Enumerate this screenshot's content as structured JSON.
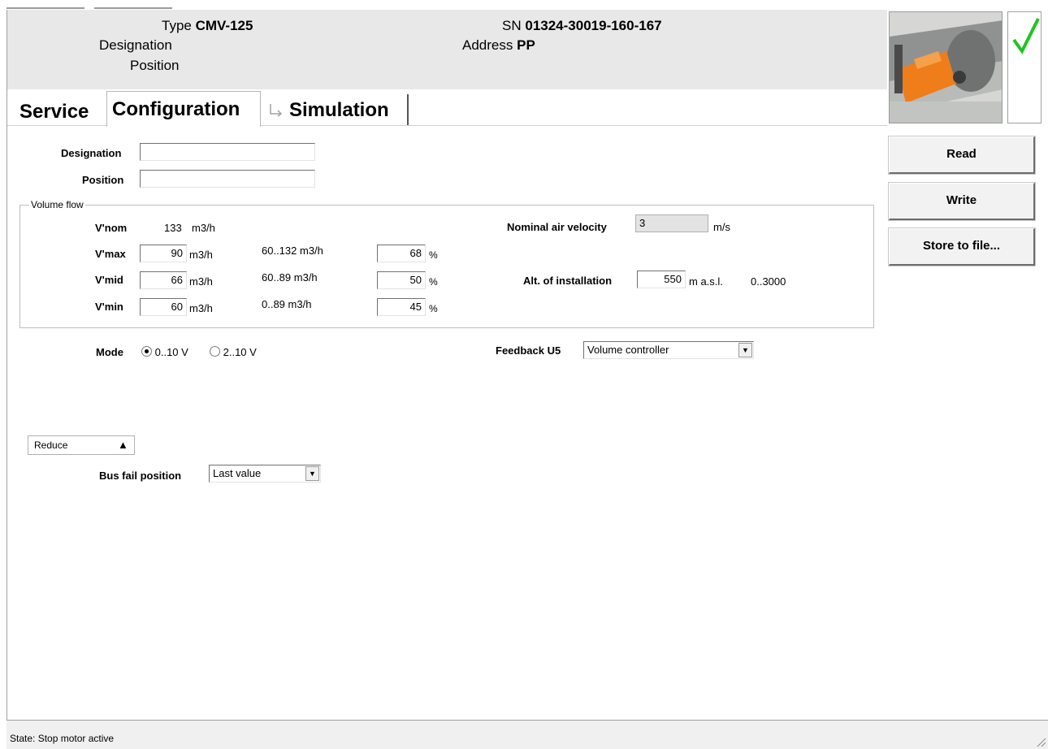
{
  "header": {
    "type_label": "Type",
    "type_value": "CMV-125",
    "designation_label": "Designation",
    "position_label": "Position",
    "sn_label": "SN",
    "sn_value": "01324-30019-160-167",
    "address_label": "Address",
    "address_value": "PP",
    "status_icon": "checkmark-icon",
    "status_color": "#22c322"
  },
  "tabs": [
    {
      "label": "Service"
    },
    {
      "label": "Configuration"
    },
    {
      "label": "Simulation",
      "icon": "route-icon"
    }
  ],
  "form": {
    "designation_label": "Designation",
    "designation_value": "",
    "position_label": "Position",
    "position_value": ""
  },
  "volume_flow": {
    "title": "Volume flow",
    "vnom_label": "V'nom",
    "vnom_value": "133",
    "vnom_unit": "m3/h",
    "vmax_label": "V'max",
    "vmax_value": "90",
    "vmax_unit": "m3/h",
    "vmax_range": "60..132 m3/h",
    "vmax_percent": "68",
    "vmid_label": "V'mid",
    "vmid_value": "66",
    "vmid_unit": "m3/h",
    "vmid_range": "60..89 m3/h",
    "vmid_percent": "50",
    "vmin_label": "V'min",
    "vmin_value": "60",
    "vmin_unit": "m3/h",
    "vmin_range": "0..89 m3/h",
    "vmin_percent": "45",
    "percent_sign": "%",
    "nominal_air_velocity_label": "Nominal air velocity",
    "nominal_air_velocity_value": "3",
    "nominal_air_velocity_unit": "m/s",
    "alt_label": "Alt. of installation",
    "alt_value": "550",
    "alt_unit": "m a.s.l.",
    "alt_range": "0..3000"
  },
  "mode": {
    "label": "Mode",
    "option1": "0..10 V",
    "option2": "2..10 V",
    "selected": "0..10 V"
  },
  "feedback": {
    "label": "Feedback U5",
    "value": "Volume controller"
  },
  "reduce": {
    "label": "Reduce",
    "arrow": "▲"
  },
  "bus_fail": {
    "label": "Bus fail position",
    "value": "Last value"
  },
  "buttons": {
    "read": "Read",
    "write": "Write",
    "store": "Store to file..."
  },
  "status_bar": {
    "text": "State: Stop motor active"
  }
}
